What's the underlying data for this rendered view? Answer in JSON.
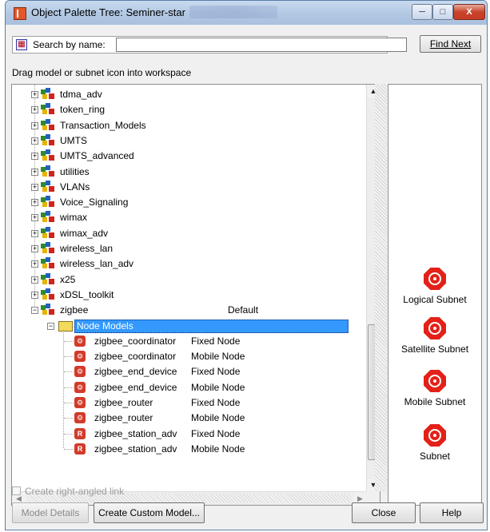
{
  "window": {
    "title": "Object Palette Tree: Seminer-star",
    "min_label": "─",
    "max_label": "□",
    "close_label": "X"
  },
  "search": {
    "label": "Search by name:",
    "value": "",
    "find_next_label": "Find Next"
  },
  "hint": "Drag model or subnet icon into workspace",
  "tree": {
    "libraries": [
      {
        "label": "tdma_adv"
      },
      {
        "label": "token_ring"
      },
      {
        "label": "Transaction_Models"
      },
      {
        "label": "UMTS"
      },
      {
        "label": "UMTS_advanced"
      },
      {
        "label": "utilities"
      },
      {
        "label": "VLANs"
      },
      {
        "label": "Voice_Signaling"
      },
      {
        "label": "wimax"
      },
      {
        "label": "wimax_adv"
      },
      {
        "label": "wireless_lan"
      },
      {
        "label": "wireless_lan_adv"
      },
      {
        "label": "x25"
      },
      {
        "label": "xDSL_toolkit"
      }
    ],
    "expanded_library": {
      "label": "zigbee",
      "column": "Default"
    },
    "folder": {
      "label": "Node Models"
    },
    "node_models": [
      {
        "name": "zigbee_coordinator",
        "type": "Fixed Node"
      },
      {
        "name": "zigbee_coordinator",
        "type": "Mobile Node"
      },
      {
        "name": "zigbee_end_device",
        "type": "Fixed Node"
      },
      {
        "name": "zigbee_end_device",
        "type": "Mobile Node"
      },
      {
        "name": "zigbee_router",
        "type": "Fixed Node"
      },
      {
        "name": "zigbee_router",
        "type": "Mobile Node"
      },
      {
        "name": "zigbee_station_adv",
        "type": "Fixed Node"
      },
      {
        "name": "zigbee_station_adv",
        "type": "Mobile Node"
      }
    ]
  },
  "subnets": [
    {
      "label": "Logical Subnet"
    },
    {
      "label": "Satellite Subnet"
    },
    {
      "label": "Mobile Subnet"
    },
    {
      "label": "Subnet"
    }
  ],
  "options": {
    "right_angled_label": "Create right-angled link"
  },
  "buttons": {
    "model_details": "Model Details",
    "create_custom": "Create Custom Model...",
    "close": "Close",
    "help": "Help"
  },
  "colors": {
    "selection": "#3399ff",
    "subnet_red": "#e32119"
  }
}
